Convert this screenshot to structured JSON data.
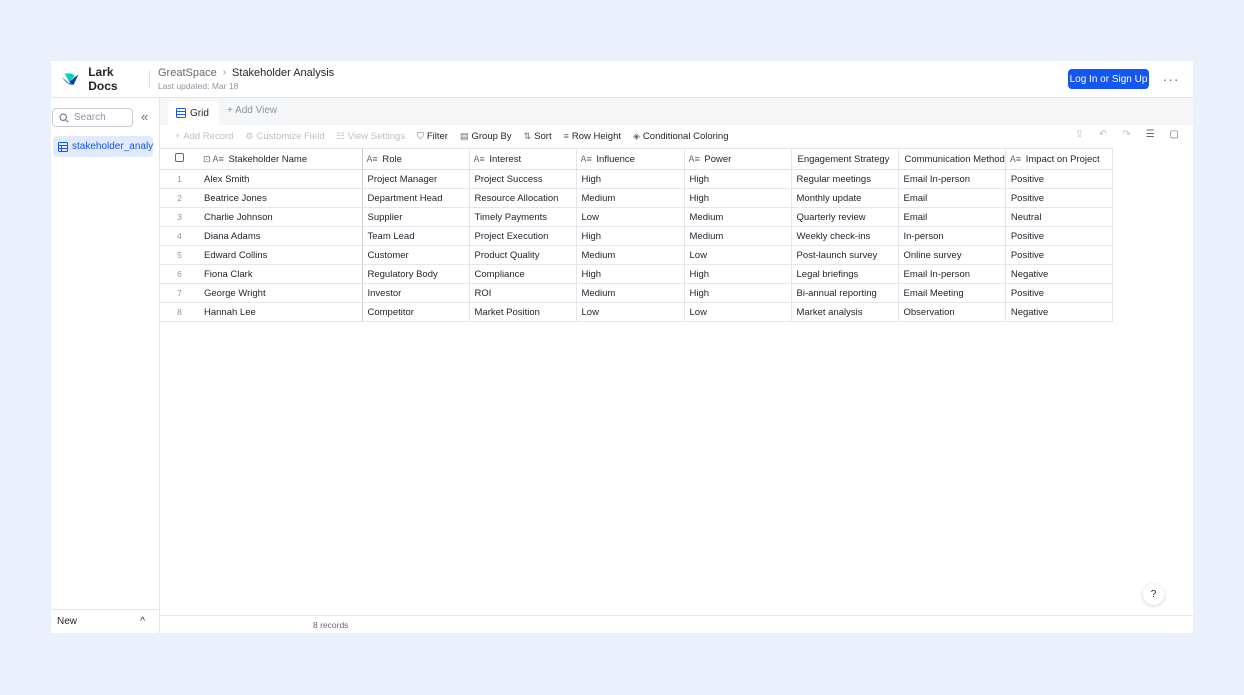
{
  "header": {
    "app_name": "Lark Docs",
    "breadcrumb_parent": "GreatSpace",
    "breadcrumb_sep": "›",
    "breadcrumb_current": "Stakeholder Analysis",
    "last_updated": "Last updated: Mar 18",
    "login_label": "Log In or Sign Up",
    "more_label": "···"
  },
  "sidebar": {
    "search_placeholder": "Search",
    "collapse_label": "«",
    "table_name": "stakeholder_analy...",
    "new_label": "New",
    "new_chevron": "^"
  },
  "views": {
    "active_label": "Grid",
    "add_label": "+ Add View"
  },
  "toolbar": {
    "add_record": "Add Record",
    "customize_field": "Customize Field",
    "view_settings": "View Settings",
    "filter": "Filter",
    "group_by": "Group By",
    "sort": "Sort",
    "row_height": "Row Height",
    "conditional_coloring": "Conditional Coloring"
  },
  "table": {
    "columns": [
      {
        "label": "Stakeholder Name",
        "icon": "A≡"
      },
      {
        "label": "Role",
        "icon": "A≡"
      },
      {
        "label": "Interest",
        "icon": "A≡"
      },
      {
        "label": "Influence",
        "icon": "A≡"
      },
      {
        "label": "Power",
        "icon": "A≡"
      },
      {
        "label": "Engagement Strategy",
        "icon": ""
      },
      {
        "label": "Communication Method",
        "icon": ""
      },
      {
        "label": "Impact on Project",
        "icon": "A≡"
      }
    ],
    "rows": [
      {
        "index": "1",
        "cells": [
          "Alex Smith",
          "Project Manager",
          "Project Success",
          "High",
          "High",
          "Regular meetings",
          "Email In-person",
          "Positive"
        ]
      },
      {
        "index": "2",
        "cells": [
          "Beatrice Jones",
          "Department Head",
          "Resource Allocation",
          "Medium",
          "High",
          "Monthly update",
          "Email",
          "Positive"
        ]
      },
      {
        "index": "3",
        "cells": [
          "Charlie Johnson",
          "Supplier",
          "Timely Payments",
          "Low",
          "Medium",
          "Quarterly review",
          "Email",
          "Neutral"
        ]
      },
      {
        "index": "4",
        "cells": [
          "Diana Adams",
          "Team Lead",
          "Project Execution",
          "High",
          "Medium",
          "Weekly check-ins",
          "In-person",
          "Positive"
        ]
      },
      {
        "index": "5",
        "cells": [
          "Edward Collins",
          "Customer",
          "Product Quality",
          "Medium",
          "Low",
          "Post-launch survey",
          "Online survey",
          "Positive"
        ]
      },
      {
        "index": "6",
        "cells": [
          "Fiona Clark",
          "Regulatory Body",
          "Compliance",
          "High",
          "High",
          "Legal briefings",
          "Email In-person",
          "Negative"
        ]
      },
      {
        "index": "7",
        "cells": [
          "George Wright",
          "Investor",
          "ROI",
          "Medium",
          "High",
          "Bi-annual reporting",
          "Email Meeting",
          "Positive"
        ]
      },
      {
        "index": "8",
        "cells": [
          "Hannah Lee",
          "Competitor",
          "Market Position",
          "Low",
          "Low",
          "Market analysis",
          "Observation",
          "Negative"
        ]
      }
    ],
    "record_count": "8 records"
  },
  "help_label": "?",
  "colors": {
    "primary": "#1456f0",
    "page_bg": "#eaf1fd",
    "selected_bg": "#e1eaff"
  }
}
